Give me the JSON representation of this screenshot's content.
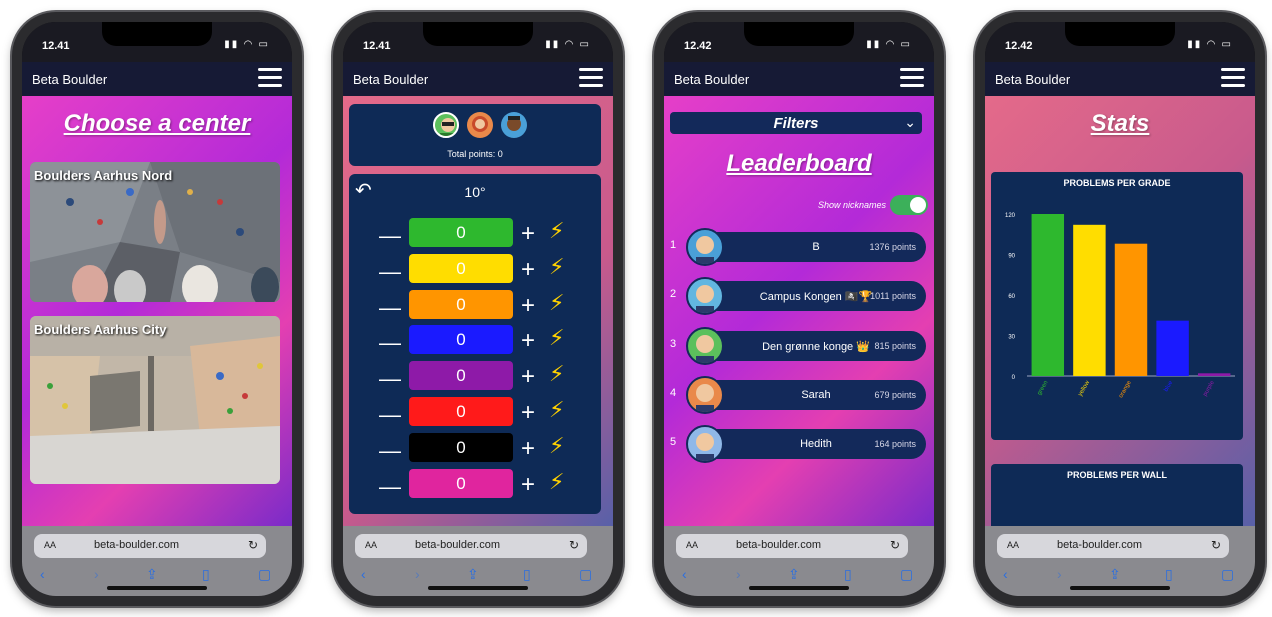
{
  "app_title": "Beta Boulder",
  "url": "beta-boulder.com",
  "browser_aa": "AA",
  "phones": [
    {
      "time": "12.41"
    },
    {
      "time": "12.41"
    },
    {
      "time": "12.42"
    },
    {
      "time": "12.42"
    }
  ],
  "centers": {
    "heading": "Choose a center",
    "items": [
      {
        "label": "Boulders Aarhus Nord"
      },
      {
        "label": "Boulders Aarhus City"
      }
    ]
  },
  "session": {
    "total_points": "Total points: 0",
    "angle": "10°",
    "grades": [
      {
        "count": "0",
        "color": "#2eb82e"
      },
      {
        "count": "0",
        "color": "#ffdd00"
      },
      {
        "count": "0",
        "color": "#ff9500"
      },
      {
        "count": "0",
        "color": "#1a1aff"
      },
      {
        "count": "0",
        "color": "#8e1aa8"
      },
      {
        "count": "0",
        "color": "#ff1a1a"
      },
      {
        "count": "0",
        "color": "#000000"
      },
      {
        "count": "0",
        "color": "#e0259e"
      }
    ]
  },
  "leaderboard": {
    "filters_label": "Filters",
    "heading": "Leaderboard",
    "show_nicknames": "Show nicknames",
    "entries": [
      {
        "rank": "1",
        "name": "B",
        "points": "1376 points",
        "avatar_color": "#4aa0d8"
      },
      {
        "rank": "2",
        "name": "Campus Kongen 🏴‍☠️🏆",
        "points": "1011 points",
        "avatar_color": "#62b6e0"
      },
      {
        "rank": "3",
        "name": "Den grønne konge 👑",
        "points": "815 points",
        "avatar_color": "#5cc05c"
      },
      {
        "rank": "4",
        "name": "Sarah",
        "points": "679 points",
        "avatar_color": "#e9894a"
      },
      {
        "rank": "5",
        "name": "Hedith",
        "points": "164 points",
        "avatar_color": "#8fb8e8"
      }
    ]
  },
  "stats": {
    "heading": "Stats",
    "second_chart_title": "PROBLEMS PER WALL"
  },
  "chart_data": {
    "type": "bar",
    "title": "PROBLEMS PER GRADE",
    "categories": [
      "green",
      "yellow",
      "orange",
      "blue",
      "purple"
    ],
    "values": [
      120,
      112,
      98,
      41,
      2
    ],
    "colors": [
      "#2eb82e",
      "#ffdd00",
      "#ff9500",
      "#1a1aff",
      "#8e1aa8"
    ],
    "yticks": [
      0,
      30,
      60,
      90,
      120
    ],
    "ylim": [
      0,
      120
    ],
    "grid": false
  }
}
